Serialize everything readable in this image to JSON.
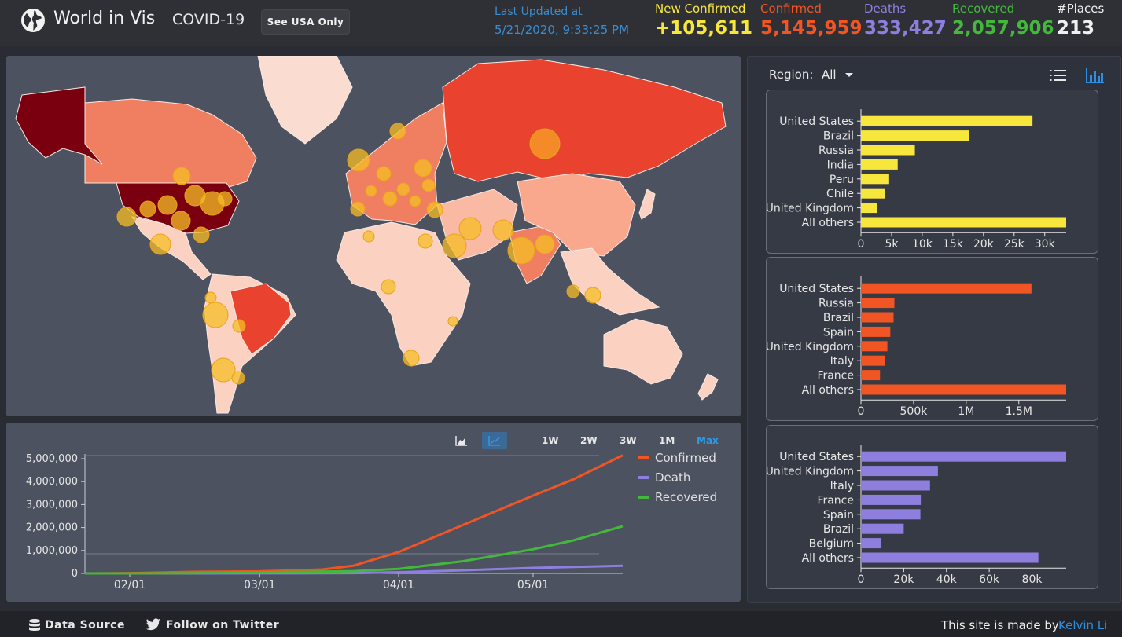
{
  "header": {
    "brand": "World in Vis",
    "subtitle": "COVID-19",
    "usa_button": "See USA Only",
    "updated_label": "Last Updated at",
    "updated_value": "5/21/2020, 9:33:25 PM",
    "stats": [
      {
        "label": "New Confirmed",
        "value": "+105,611",
        "color": "#f7e73d"
      },
      {
        "label": "Confirmed",
        "value": "5,145,959",
        "color": "#f05523"
      },
      {
        "label": "Deaths",
        "value": "333,427",
        "color": "#8e7fdf"
      },
      {
        "label": "Recovered",
        "value": "2,057,906",
        "color": "#44b83c"
      },
      {
        "label": "#Places",
        "value": "213",
        "color": "#f0f0f0"
      }
    ]
  },
  "timeline": {
    "range_buttons": [
      "1W",
      "2W",
      "3W",
      "1M",
      "Max"
    ],
    "active_range": "Max",
    "legend": [
      {
        "name": "Confirmed",
        "color": "#f05523"
      },
      {
        "name": "Death",
        "color": "#8e7fdf"
      },
      {
        "name": "Recovered",
        "color": "#44b83c"
      }
    ]
  },
  "region": {
    "label": "Region:",
    "value": "All"
  },
  "footer": {
    "data_source": "Data Source",
    "twitter": "Follow on Twitter",
    "credit": "This site is made by",
    "author": "Kelvin Li"
  },
  "chart_data": [
    {
      "type": "line",
      "x": [
        "2020-01-22",
        "2020-02-01",
        "2020-02-15",
        "2020-03-01",
        "2020-03-15",
        "2020-03-22",
        "2020-04-01",
        "2020-04-15",
        "2020-05-01",
        "2020-05-10",
        "2020-05-21"
      ],
      "xticks": [
        "02/01",
        "03/01",
        "04/01",
        "05/01"
      ],
      "series": [
        {
          "name": "Confirmed",
          "values": [
            555,
            12000,
            69000,
            88000,
            170000,
            340000,
            930000,
            2080000,
            3390000,
            4100000,
            5145959
          ]
        },
        {
          "name": "Death",
          "values": [
            17,
            260,
            1660,
            3000,
            6500,
            15000,
            51000,
            135000,
            240000,
            285000,
            333427
          ]
        },
        {
          "name": "Recovered",
          "values": [
            28,
            300,
            9000,
            43000,
            78000,
            100000,
            195000,
            520000,
            1050000,
            1440000,
            2057906
          ]
        }
      ],
      "yticks": [
        "0",
        "1,000,000",
        "2,000,000",
        "3,000,000",
        "4,000,000",
        "5,000,000"
      ],
      "ylim": [
        0,
        5000000
      ],
      "grid": false,
      "legend": "right"
    },
    {
      "type": "bar",
      "orientation": "horizontal",
      "categories": [
        "United States",
        "Brazil",
        "Russia",
        "India",
        "Peru",
        "Chile",
        "United Kingdom",
        "All others"
      ],
      "values": [
        28000,
        17600,
        8800,
        6000,
        4600,
        3900,
        2600,
        33500
      ],
      "xticks": [
        "0",
        "5k",
        "10k",
        "15k",
        "20k",
        "25k",
        "30k"
      ],
      "xlim": [
        0,
        33500
      ],
      "color": "#f7e73d"
    },
    {
      "type": "bar",
      "orientation": "horizontal",
      "categories": [
        "United States",
        "Russia",
        "Brazil",
        "Spain",
        "United Kingdom",
        "Italy",
        "France",
        "All others"
      ],
      "values": [
        1620000,
        318000,
        310000,
        279000,
        251000,
        228000,
        181000,
        1950000
      ],
      "xticks": [
        "0",
        "500k",
        "1M",
        "1.5M"
      ],
      "xlim": [
        0,
        1950000
      ],
      "color": "#f05523"
    },
    {
      "type": "bar",
      "orientation": "horizontal",
      "categories": [
        "United States",
        "United Kingdom",
        "Italy",
        "France",
        "Spain",
        "Brazil",
        "Belgium",
        "All others"
      ],
      "values": [
        96000,
        36000,
        32300,
        28000,
        27800,
        20000,
        9200,
        83000
      ],
      "xticks": [
        "0",
        "20k",
        "40k",
        "60k",
        "80k"
      ],
      "xlim": [
        0,
        96000
      ],
      "color": "#8e7fdf"
    }
  ]
}
